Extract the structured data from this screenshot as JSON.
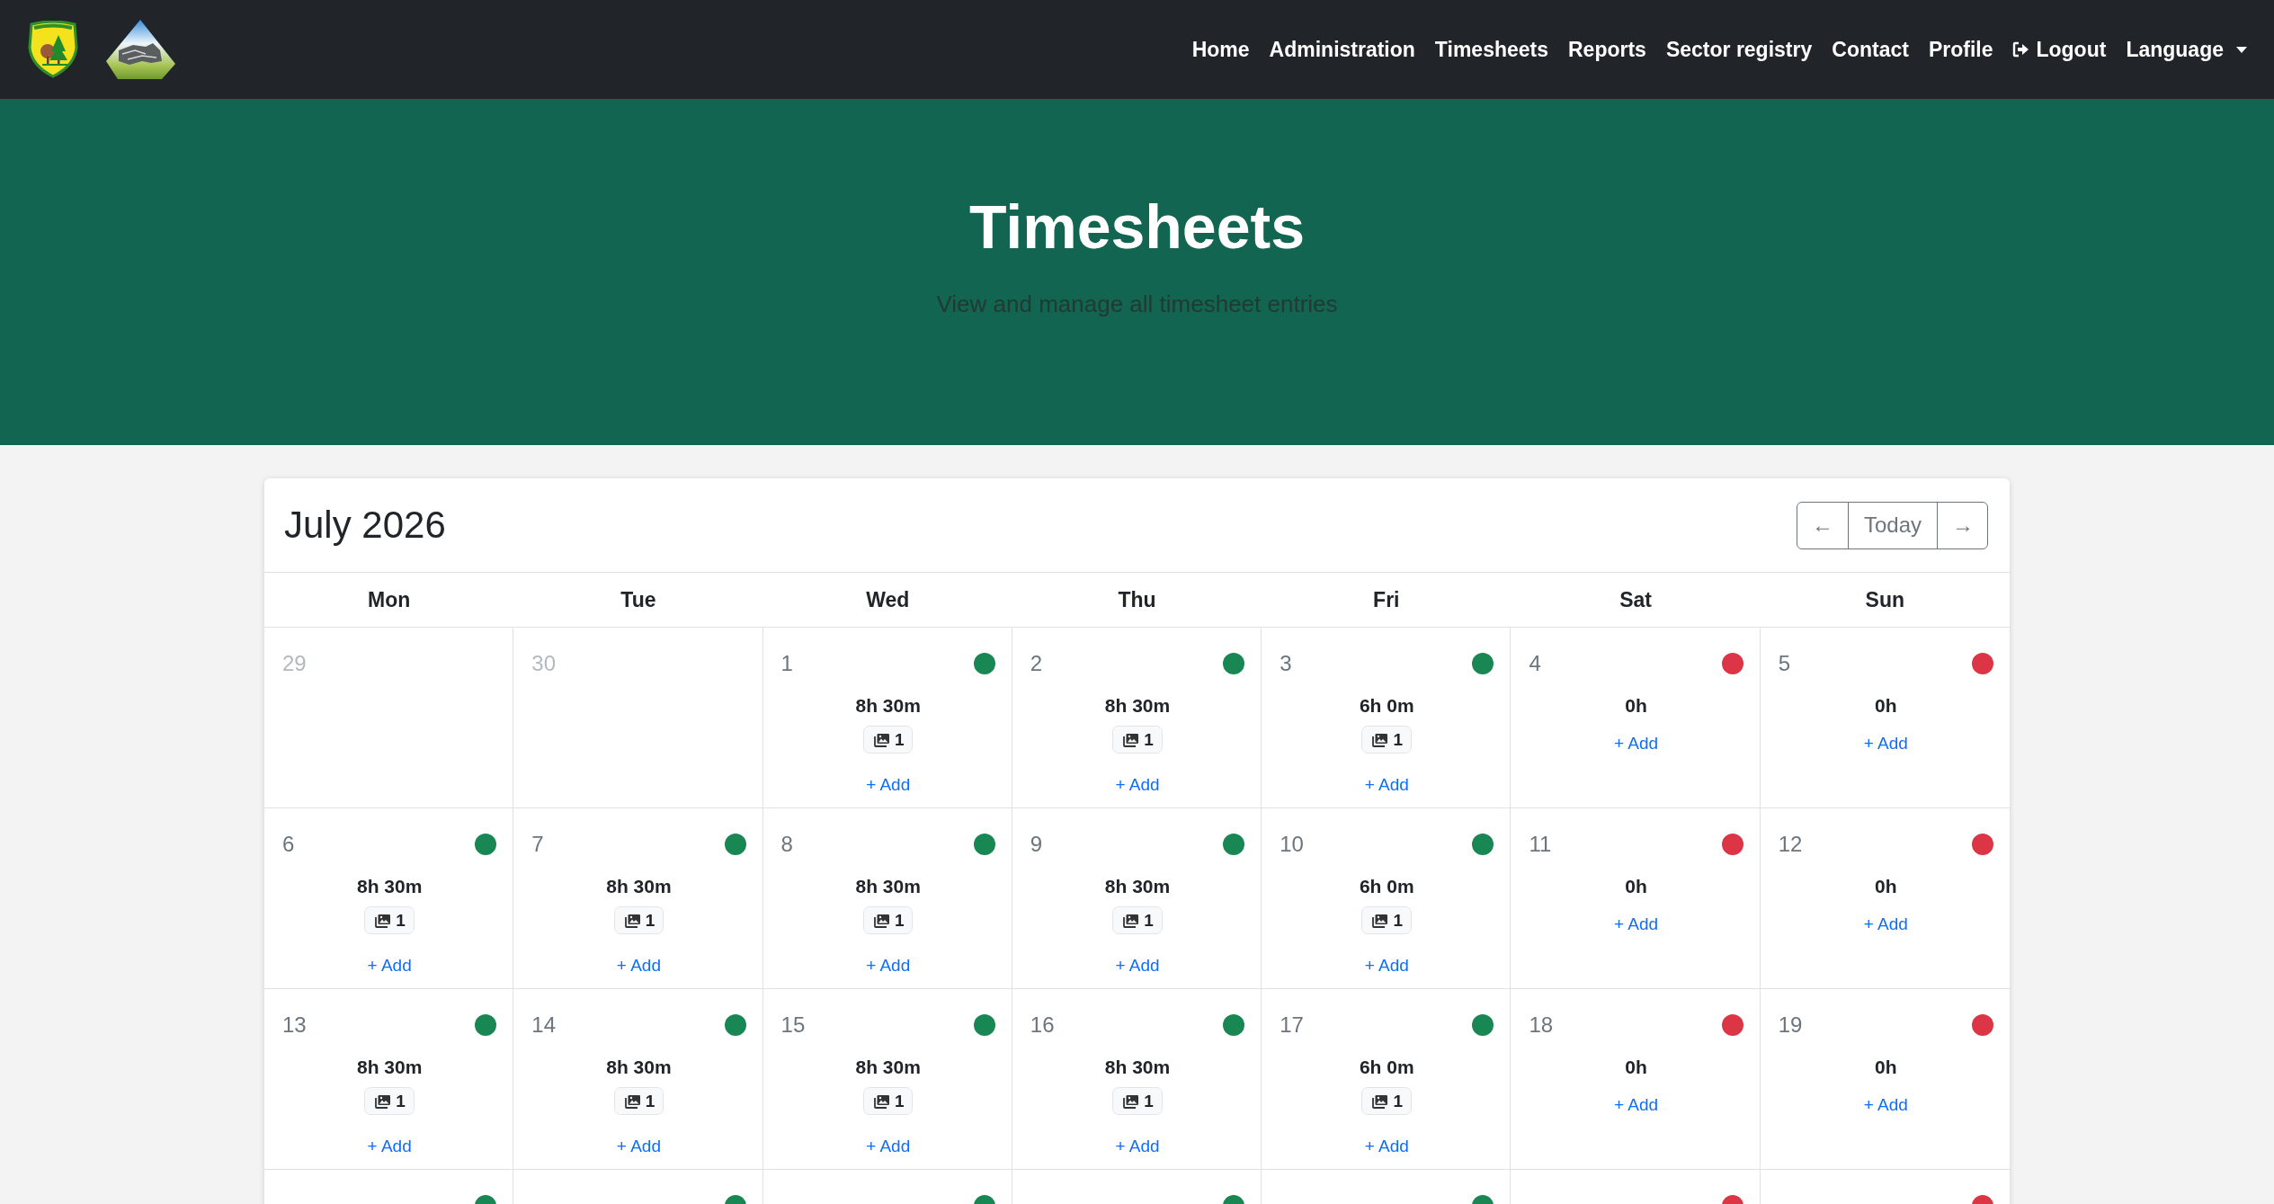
{
  "navbar": {
    "links": [
      {
        "label": "Home",
        "kind": "link"
      },
      {
        "label": "Administration",
        "kind": "link"
      },
      {
        "label": "Timesheets",
        "kind": "link"
      },
      {
        "label": "Reports",
        "kind": "link"
      },
      {
        "label": "Sector registry",
        "kind": "link"
      },
      {
        "label": "Contact",
        "kind": "link"
      },
      {
        "label": "Profile",
        "kind": "link"
      },
      {
        "label": "Logout",
        "kind": "logout"
      },
      {
        "label": "Language",
        "kind": "dropdown"
      }
    ]
  },
  "hero": {
    "title": "Timesheets",
    "subtitle": "View and manage all timesheet entries"
  },
  "calendar": {
    "title": "July 2026",
    "controls": [
      {
        "label": "←",
        "kind": "prev"
      },
      {
        "label": "Today",
        "kind": "today"
      },
      {
        "label": "→",
        "kind": "next"
      }
    ],
    "weekdays": [
      "Mon",
      "Tue",
      "Wed",
      "Thu",
      "Fri",
      "Sat",
      "Sun"
    ],
    "weeks": [
      {
        "days": [
          {
            "day": "29",
            "in_month": false
          },
          {
            "day": "30",
            "in_month": false
          },
          {
            "day": "1",
            "in_month": true,
            "color": "#198754",
            "hours": "8h 30m",
            "photos": "1",
            "add": "+ Add"
          },
          {
            "day": "2",
            "in_month": true,
            "color": "#198754",
            "hours": "8h 30m",
            "photos": "1",
            "add": "+ Add"
          },
          {
            "day": "3",
            "in_month": true,
            "color": "#198754",
            "hours": "6h 0m",
            "photos": "1",
            "add": "+ Add"
          },
          {
            "day": "4",
            "in_month": true,
            "color": "#dc3545",
            "hours": "0h",
            "add": "+ Add"
          },
          {
            "day": "5",
            "in_month": true,
            "color": "#dc3545",
            "hours": "0h",
            "add": "+ Add"
          }
        ]
      },
      {
        "days": [
          {
            "day": "6",
            "in_month": true,
            "color": "#198754",
            "hours": "8h 30m",
            "photos": "1",
            "add": "+ Add"
          },
          {
            "day": "7",
            "in_month": true,
            "color": "#198754",
            "hours": "8h 30m",
            "photos": "1",
            "add": "+ Add"
          },
          {
            "day": "8",
            "in_month": true,
            "color": "#198754",
            "hours": "8h 30m",
            "photos": "1",
            "add": "+ Add"
          },
          {
            "day": "9",
            "in_month": true,
            "color": "#198754",
            "hours": "8h 30m",
            "photos": "1",
            "add": "+ Add"
          },
          {
            "day": "10",
            "in_month": true,
            "color": "#198754",
            "hours": "6h 0m",
            "photos": "1",
            "add": "+ Add"
          },
          {
            "day": "11",
            "in_month": true,
            "color": "#dc3545",
            "hours": "0h",
            "add": "+ Add"
          },
          {
            "day": "12",
            "in_month": true,
            "color": "#dc3545",
            "hours": "0h",
            "add": "+ Add"
          }
        ]
      },
      {
        "days": [
          {
            "day": "13",
            "in_month": true,
            "color": "#198754",
            "hours": "8h 30m",
            "photos": "1",
            "add": "+ Add"
          },
          {
            "day": "14",
            "in_month": true,
            "color": "#198754",
            "hours": "8h 30m",
            "photos": "1",
            "add": "+ Add"
          },
          {
            "day": "15",
            "in_month": true,
            "color": "#198754",
            "hours": "8h 30m",
            "photos": "1",
            "add": "+ Add"
          },
          {
            "day": "16",
            "in_month": true,
            "color": "#198754",
            "hours": "8h 30m",
            "photos": "1",
            "add": "+ Add"
          },
          {
            "day": "17",
            "in_month": true,
            "color": "#198754",
            "hours": "6h 0m",
            "photos": "1",
            "add": "+ Add"
          },
          {
            "day": "18",
            "in_month": true,
            "color": "#dc3545",
            "hours": "0h",
            "add": "+ Add"
          },
          {
            "day": "19",
            "in_month": true,
            "color": "#dc3545",
            "hours": "0h",
            "add": "+ Add"
          }
        ]
      },
      {
        "days": [
          {
            "color": "#198754"
          },
          {
            "color": "#198754"
          },
          {
            "color": "#198754"
          },
          {
            "color": "#198754"
          },
          {
            "color": "#198754"
          },
          {
            "color": "#dc3545"
          },
          {
            "color": "#dc3545"
          }
        ]
      }
    ]
  }
}
